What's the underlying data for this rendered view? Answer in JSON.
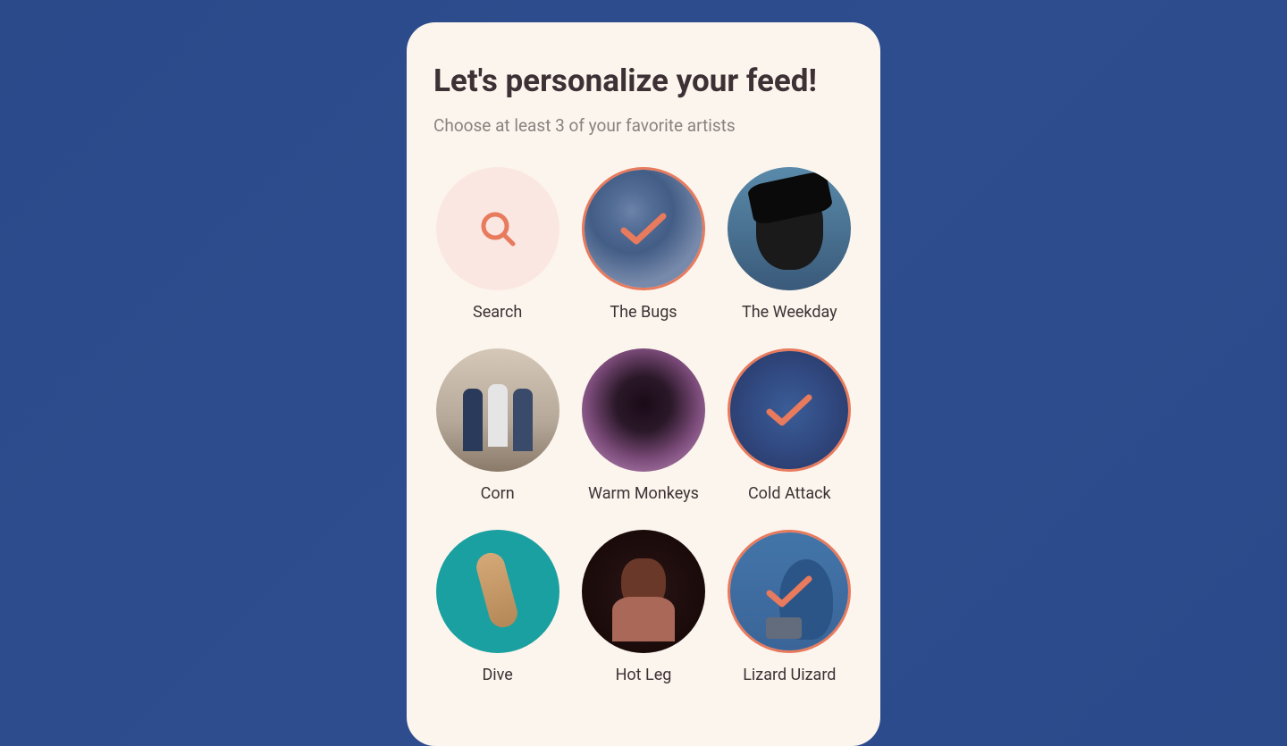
{
  "header": {
    "title": "Let's personalize your feed!",
    "subtitle": "Choose at least 3 of your favorite artists"
  },
  "colors": {
    "accent": "#e87a5d",
    "cardBg": "#fcf5ed",
    "pageBg": "#2c4d93"
  },
  "tiles": [
    {
      "id": "search",
      "label": "Search",
      "type": "search",
      "selected": false
    },
    {
      "id": "bugs",
      "label": "The Bugs",
      "type": "artist",
      "selected": true
    },
    {
      "id": "weekday",
      "label": "The Weekday",
      "type": "artist",
      "selected": false
    },
    {
      "id": "corn",
      "label": "Corn",
      "type": "artist",
      "selected": false
    },
    {
      "id": "monkeys",
      "label": "Warm Monkeys",
      "type": "artist",
      "selected": false
    },
    {
      "id": "cold",
      "label": "Cold Attack",
      "type": "artist",
      "selected": true
    },
    {
      "id": "dive",
      "label": "Dive",
      "type": "artist",
      "selected": false
    },
    {
      "id": "hotleg",
      "label": "Hot Leg",
      "type": "artist",
      "selected": false
    },
    {
      "id": "lizard",
      "label": "Lizard Uizard",
      "type": "artist",
      "selected": true
    }
  ]
}
